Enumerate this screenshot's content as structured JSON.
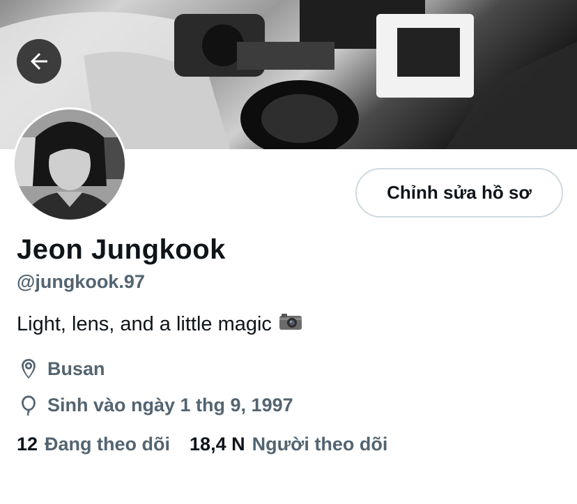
{
  "header": {
    "back_icon": "arrow-left-icon"
  },
  "profile": {
    "edit_button_label": "Chỉnh sửa hồ sơ",
    "display_name": "Jeon Jungkook",
    "handle": "@jungkook.97",
    "bio": "Light, lens, and a little magic",
    "bio_emoji": "camera-icon",
    "location": "Busan",
    "location_icon": "location-pin-icon",
    "birthday": "Sinh vào ngày 1 thg 9, 1997",
    "birthday_icon": "balloon-icon"
  },
  "stats": {
    "following_count": "12",
    "following_label": "Đang theo dõi",
    "followers_count": "18,4 N",
    "followers_label": "Người theo dõi"
  },
  "colors": {
    "primary_text": "#0f1419",
    "secondary_text": "#536471",
    "border": "#cfd9de"
  }
}
